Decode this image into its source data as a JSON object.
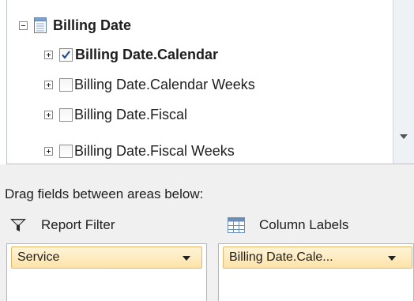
{
  "tree": {
    "root": {
      "label": "Billing Date",
      "expander": "minus",
      "icon": "field-list-icon"
    },
    "items": [
      {
        "label": "Billing Date.Calendar",
        "checked": true,
        "bold": true
      },
      {
        "label": "Billing Date.Calendar Weeks",
        "checked": false,
        "bold": false
      },
      {
        "label": "Billing Date.Fiscal",
        "checked": false,
        "bold": false
      },
      {
        "label": "Billing Date.Fiscal Weeks",
        "checked": false,
        "bold": false
      }
    ]
  },
  "instructions": "Drag fields between areas below:",
  "areas": {
    "report_filter": {
      "title": "Report Filter",
      "icon": "filter-funnel-icon",
      "field": "Service"
    },
    "column_labels": {
      "title": "Column Labels",
      "icon": "column-grid-icon",
      "field": "Billing Date.Cale..."
    }
  },
  "colors": {
    "pill_border": "#e3b86b",
    "pill_fill": "#fde3a7",
    "checkmark": "#2a4f8f"
  }
}
